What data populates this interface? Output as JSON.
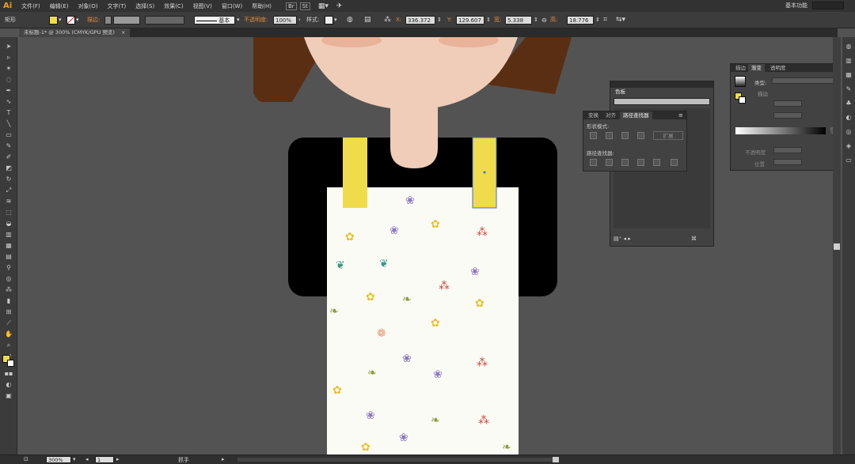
{
  "app": {
    "logo": "Ai",
    "workspace": "基本功能"
  },
  "menu": [
    "文件(F)",
    "编辑(E)",
    "对象(O)",
    "文字(T)",
    "选择(S)",
    "效果(C)",
    "视图(V)",
    "窗口(W)",
    "帮助(H)"
  ],
  "menu_extra": {
    "br_label": "Br",
    "st_label": "St"
  },
  "control": {
    "object_type": "矩形",
    "stroke_label": "描边:",
    "stroke_style": "基本",
    "opacity_label": "不透明度:",
    "opacity_value": "100%",
    "style_label": "样式:",
    "x_label": "X:",
    "x_value": "336.372",
    "y_label": "Y:",
    "y_value": "129.607",
    "w_label": "宽:",
    "w_value": "5.338 mm",
    "h_label": "高:",
    "h_value": "18.776 mm",
    "fill_color": "#f0dc4a"
  },
  "document": {
    "tab_title": "未标题-1* @ 300% (CMYK/GPU 预览)"
  },
  "colors": {
    "hair": "#5a2e12",
    "skin": "#efcdb8",
    "cheek": "#e8b39a",
    "shirt": "#000000",
    "strap": "#f0dc4a",
    "apron": "#fbfbf6"
  },
  "swatches_panel": {
    "title": "色板"
  },
  "pathfinder_panel": {
    "tabs": [
      "变换",
      "对齐",
      "路径查找器"
    ],
    "shape_modes_label": "形状模式:",
    "expand_button": "扩展",
    "pathfinders_label": "路径查找器:"
  },
  "gradient_panel": {
    "tabs": [
      "描边",
      "渐变",
      "透明度"
    ],
    "type_label": "类型:",
    "stroke_label": "描边",
    "opacity_label": "不透明度",
    "location_label": "位置"
  },
  "status": {
    "zoom": "300%",
    "page": "1",
    "tool_name": "抓手"
  }
}
